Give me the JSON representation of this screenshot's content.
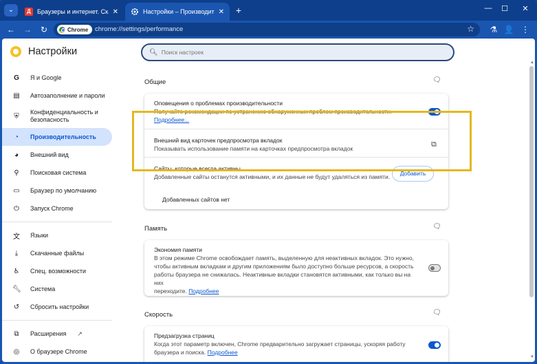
{
  "tabs": [
    {
      "title": "Браузеры и интернет. Скачать",
      "favicon": "Д",
      "close": "✕"
    },
    {
      "title": "Настройки – Производительност",
      "favicon": "gear-icon",
      "close": "✕"
    }
  ],
  "newtab": "+",
  "window_controls": {
    "tab_search": "⌄",
    "minimize": "—",
    "maximize": "☐",
    "close": "✕"
  },
  "toolbar": {
    "chip": "Chrome",
    "url": "chrome://settings/performance"
  },
  "settings": {
    "title": "Настройки",
    "search_placeholder": "Поиск настроек",
    "nav": [
      {
        "label": "Я и Google",
        "icon": "google-icon"
      },
      {
        "label": "Автозаполнение и пароли",
        "icon": "clipboard-icon"
      },
      {
        "label": "Конфиденциальность и безопасность",
        "icon": "shield-icon"
      },
      {
        "label": "Производительность",
        "icon": "speedometer-icon",
        "selected": true
      },
      {
        "label": "Внешний вид",
        "icon": "palette-icon"
      },
      {
        "label": "Поисковая система",
        "icon": "search-icon"
      },
      {
        "label": "Браузер по умолчанию",
        "icon": "browser-icon"
      },
      {
        "label": "Запуск Chrome",
        "icon": "power-icon"
      },
      {
        "label": "Языки",
        "icon": "translate-icon"
      },
      {
        "label": "Скачанные файлы",
        "icon": "download-icon"
      },
      {
        "label": "Спец. возможности",
        "icon": "accessibility-icon"
      },
      {
        "label": "Система",
        "icon": "wrench-icon"
      },
      {
        "label": "Сбросить настройки",
        "icon": "reset-icon"
      },
      {
        "label": "Расширения",
        "icon": "puzzle-icon"
      },
      {
        "label": "О браузере Chrome",
        "icon": "chrome-icon"
      }
    ]
  },
  "sections": {
    "general": {
      "title": "Общие",
      "alerts_title": "Оповещения о проблемах производительности",
      "alerts_desc": "Получайте рекомендации по устранению обнаруженных проблем производительности.",
      "alerts_link": "Подробнее...",
      "alerts_enabled": true,
      "hover_title": "Внешний вид карточек предпросмотра вкладок",
      "hover_desc": "Показывать использование памяти на карточках предпросмотра вкладок",
      "active_sites_title": "Сайты, которые всегда активны",
      "active_sites_desc": "Добавленные сайты останутся активными, и их данные не будут удаляться из памяти.",
      "add_button": "Добавить",
      "no_sites": "Добавленных сайтов нет"
    },
    "memory": {
      "title": "Память",
      "saver_title": "Экономия памяти",
      "saver_desc_1": "В этом режиме Chrome освобождает память, выделенную для неактивных вкладок. Это нужно,",
      "saver_desc_2": "чтобы активным вкладкам и другим приложениям было доступно больше ресурсов, а скорость",
      "saver_desc_3": "работы браузера не снижалась. Неактивные вкладки становятся активными, как только вы на них",
      "saver_desc_4": "переходите.",
      "saver_link": "Подробнее",
      "saver_enabled": false
    },
    "speed": {
      "title": "Скорость",
      "preload_title": "Предзагрузка страниц",
      "preload_desc_1": "Когда этот параметр включен, Chrome предварительно загружает страницы, ускоряя работу",
      "preload_desc_2": "браузера и поиска.",
      "preload_link": "Подробнее",
      "preload_enabled": true
    }
  },
  "colors": {
    "accent": "#0b57d0",
    "highlight": "#e4b721",
    "frame": "#1a56b0"
  }
}
